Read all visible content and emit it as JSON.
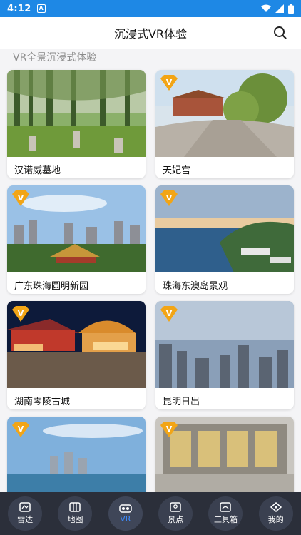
{
  "status_bar": {
    "time": "4:12",
    "sim_letter": "A"
  },
  "header": {
    "title": "沉浸式VR体验"
  },
  "section": {
    "title": "VR全景沉浸式体验"
  },
  "cards": [
    {
      "label": "汉诺威墓地",
      "premium": false
    },
    {
      "label": "天妃宫",
      "premium": true
    },
    {
      "label": "广东珠海圆明新园",
      "premium": true
    },
    {
      "label": "珠海东澳岛景观",
      "premium": true
    },
    {
      "label": "湖南零陵古城",
      "premium": true
    },
    {
      "label": "昆明日出",
      "premium": true
    },
    {
      "label": "",
      "premium": true
    },
    {
      "label": "",
      "premium": true
    }
  ],
  "tabs": [
    {
      "label": "雷达",
      "icon": "radar-icon",
      "active": false
    },
    {
      "label": "地图",
      "icon": "map-icon",
      "active": false
    },
    {
      "label": "VR",
      "icon": "vr-icon",
      "active": true
    },
    {
      "label": "景点",
      "icon": "scenic-icon",
      "active": false
    },
    {
      "label": "工具箱",
      "icon": "toolbox-icon",
      "active": false
    },
    {
      "label": "我的",
      "icon": "profile-icon",
      "active": false
    }
  ],
  "colors": {
    "status_bar": "#1e88e5",
    "tabbar": "#2b2f3a",
    "active_tab_text": "#3d8bff",
    "badge": "#f2a516"
  }
}
